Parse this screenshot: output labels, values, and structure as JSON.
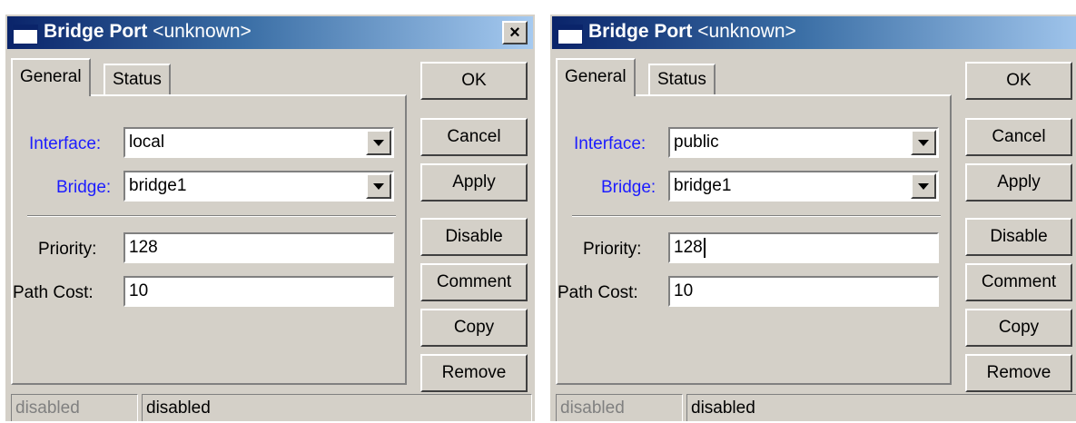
{
  "windows": [
    {
      "title_bold": "Bridge Port",
      "title_rest": "<unknown>",
      "close_glyph": "×",
      "tabs": [
        "General",
        "Status"
      ],
      "interface_label": "Interface:",
      "interface_value": "local",
      "bridge_label": "Bridge:",
      "bridge_value": "bridge1",
      "priority_label": "Priority:",
      "priority_value": "128",
      "path_cost_label": "Path Cost:",
      "path_cost_value": "10",
      "buttons": [
        "OK",
        "Cancel",
        "Apply",
        "Disable",
        "Comment",
        "Copy",
        "Remove"
      ],
      "status_left": "disabled",
      "status_right": "disabled"
    },
    {
      "title_bold": "Bridge Port",
      "title_rest": "<unknown>",
      "close_glyph": "×",
      "tabs": [
        "General",
        "Status"
      ],
      "interface_label": "Interface:",
      "interface_value": "public",
      "bridge_label": "Bridge:",
      "bridge_value": "bridge1",
      "priority_label": "Priority:",
      "priority_value": "128",
      "path_cost_label": "Path Cost:",
      "path_cost_value": "10",
      "buttons": [
        "OK",
        "Cancel",
        "Apply",
        "Disable",
        "Comment",
        "Copy",
        "Remove"
      ],
      "status_left": "disabled",
      "status_right": "disabled"
    }
  ]
}
